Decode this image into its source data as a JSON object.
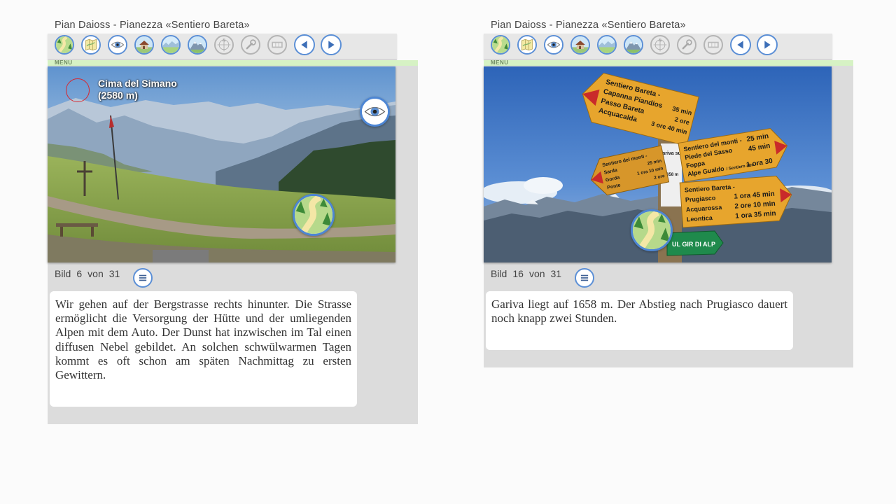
{
  "toolbar_icons": [
    "trail-icon",
    "map-icon",
    "eye-icon",
    "hut-icon",
    "panorama-icon",
    "mountain-icon",
    "compass-icon",
    "wrench-icon",
    "filmstrip-icon",
    "previous-icon",
    "next-icon"
  ],
  "menu_label": "MENU",
  "colors": {
    "accent_blue": "#5b8fd6",
    "menu_green": "#d6f2c4",
    "panel_gray": "#dcdcdc",
    "marker_red": "#d8262e"
  },
  "left": {
    "title": "Pian Daioss - Pianezza «Sentiero Bareta»",
    "peak_label_line1": "Cima del Simano",
    "peak_label_line2": "(2580 m)",
    "counter": {
      "word_image": "Bild",
      "current": "6",
      "word_of": "von",
      "total": "31"
    },
    "description": "Wir gehen auf der Bergstrasse rechts hinunter. Die Strasse ermöglicht die Versorgung der Hütte und der umliegenden Alpen mit dem Auto. Der Dunst hat inzwischen im Tal einen diffusen Nebel gebildet. An solchen schwülwarmen Tagen kommt es oft schon am späten Nachmittag zu ersten Gewittern."
  },
  "right": {
    "title": "Pian Daioss - Pianezza «Sentiero Bareta»",
    "counter": {
      "word_image": "Bild",
      "current": "16",
      "word_of": "von",
      "total": "31"
    },
    "description": "Gariva liegt auf 1658 m. Der Abstieg nach Prugiasco dauert noch knapp zwei Stunden.",
    "signpost": {
      "top_sign": [
        "Sentiero Bareta -",
        "Capanna Piandios",
        "Passo Bareta",
        "Acquacalda"
      ],
      "top_sign_times": [
        "35 min",
        "2 ore",
        "3 ore 40 min"
      ],
      "left_sign": [
        "Sentiero del monti -",
        "Sarda",
        "Gorda",
        "Ponte"
      ],
      "left_sign_times": [
        "25 min",
        "1 ora 10 min",
        "2 ore"
      ],
      "center_label": "Gariva sud",
      "center_altitude": "1658 m",
      "right_sign_1": [
        "Sentiero del monti -",
        "Piede del Sasso",
        "Foppa",
        "Alpe Gualdo"
      ],
      "right_sign_1_extra": "/ Sentiero alto",
      "right_sign_1_times": [
        "25 min",
        "45 min",
        "1 ora 30"
      ],
      "right_sign_2": [
        "Sentiero Bareta -",
        "Prugiasco",
        "Acquarossa",
        "Leontica"
      ],
      "right_sign_2_times": [
        "1 ora 45 min",
        "2 ore 10 min",
        "1 ora 35 min"
      ],
      "green_sign": "UL GIR DI ALP"
    }
  }
}
